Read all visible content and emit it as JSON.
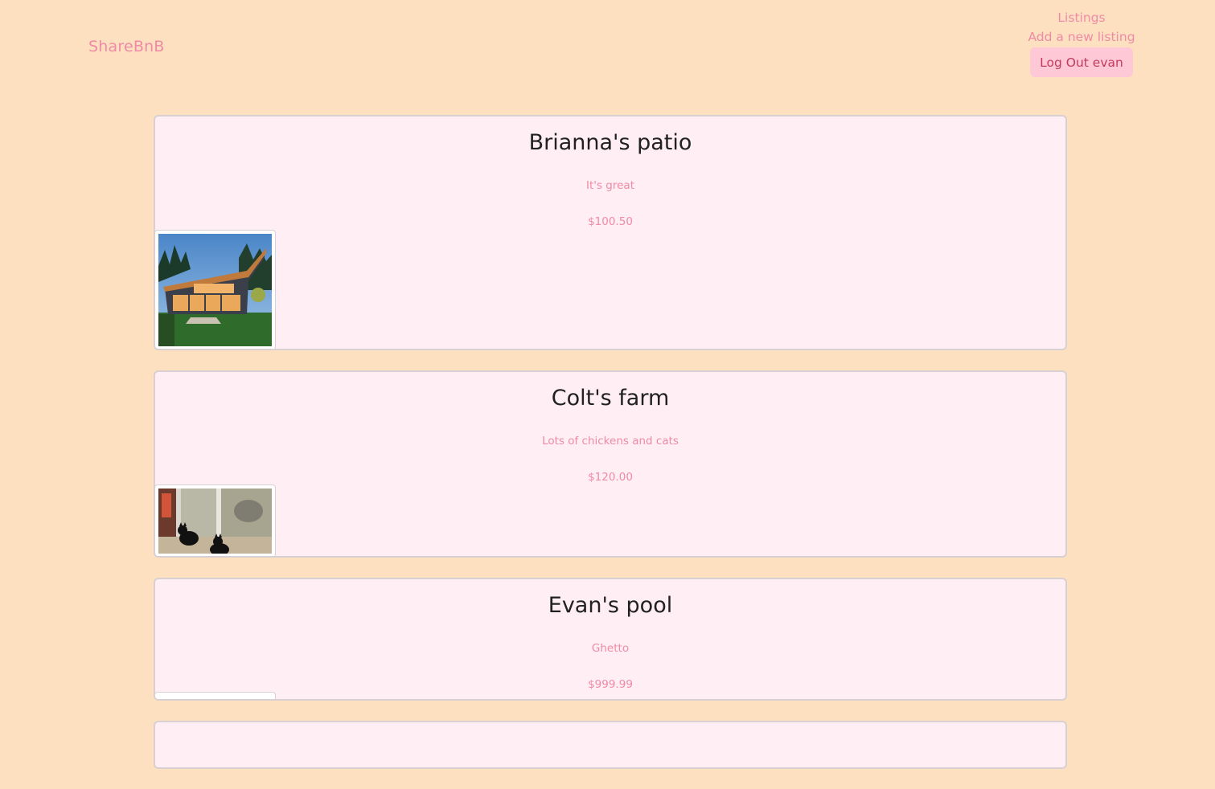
{
  "header": {
    "brand": "ShareBnB",
    "nav": {
      "listings": "Listings",
      "add_listing": "Add a new listing",
      "logout": "Log Out evan"
    }
  },
  "listings": [
    {
      "title": "Brianna's patio",
      "description": "It's great",
      "price": "$100.50",
      "image_icon": "house-photo"
    },
    {
      "title": "Colt's farm",
      "description": "Lots of chickens and cats",
      "price": "$120.00",
      "image_icon": "cats-photo"
    },
    {
      "title": "Evan's pool",
      "description": "Ghetto",
      "price": "$999.99",
      "image_icon": "broken-image"
    }
  ],
  "colors": {
    "background": "#fce0c0",
    "card_background": "#ffeef4",
    "accent_pink": "#f08aa6",
    "button_bg": "#ffc8d6",
    "button_text": "#c23a5e"
  }
}
